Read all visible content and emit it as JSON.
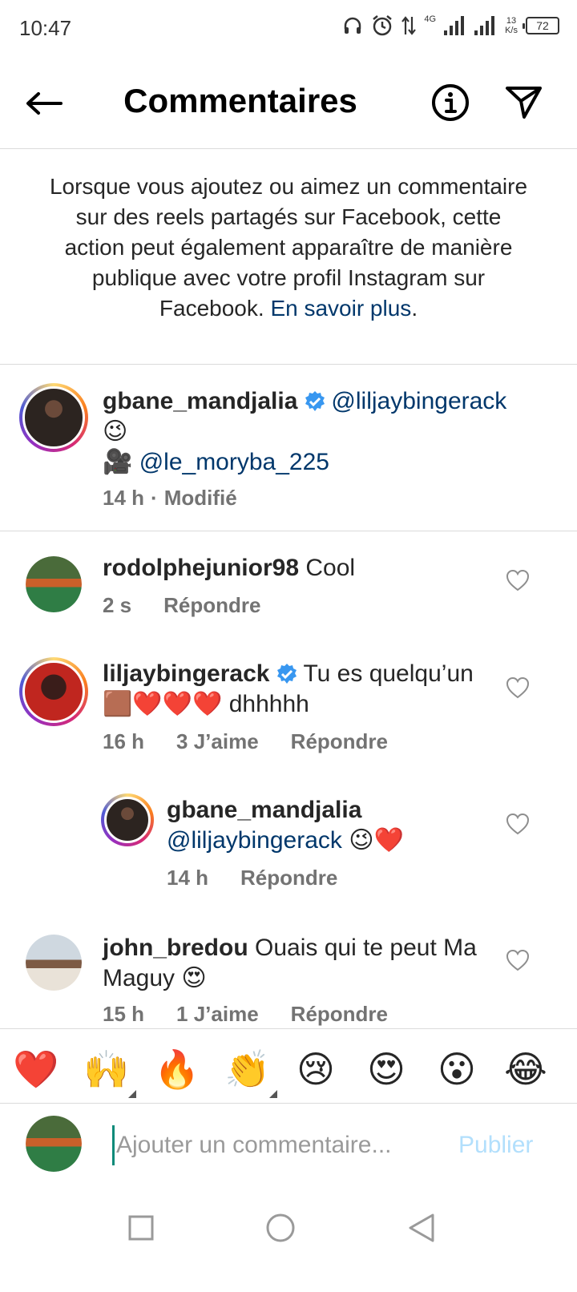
{
  "status_bar": {
    "time": "10:47",
    "network": "4G",
    "speed_value": "13",
    "speed_unit": "K/s",
    "battery": "72"
  },
  "header": {
    "title": "Commentaires",
    "back_icon": "arrow-left-icon",
    "info_icon": "info-circle-icon",
    "send_icon": "paper-plane-icon"
  },
  "notice": {
    "text": "Lorsque vous ajoutez ou aimez un commentaire sur des reels partagés sur Facebook, cette action peut également apparaître de manière publique avec votre profil Instagram sur Facebook. ",
    "link": "En savoir plus",
    "end": "."
  },
  "caption": {
    "username": "gbane_mandjalia",
    "mention1": "@liljaybingerack",
    "emoji1": "😉",
    "camera": "🎥",
    "mention2": "@le_moryba_225",
    "time": "14 h",
    "separator": "·",
    "edited": "Modifié"
  },
  "comments": [
    {
      "username": "rodolphejunior98",
      "text": "Cool",
      "time": "2 s",
      "reply": "Répondre"
    },
    {
      "username": "liljaybingerack",
      "text": "Tu es quelqu’un",
      "text2": "🟫❤️❤️❤️ dhhhhh",
      "time": "16 h",
      "likes": "3 J’aime",
      "reply": "Répondre"
    },
    {
      "username": "gbane_mandjalia",
      "mention": "@liljaybingerack",
      "text": "😉❤️",
      "time": "14 h",
      "reply": "Répondre"
    },
    {
      "username": "john_bredou",
      "text": "Ouais qui te peut Ma",
      "text2": "Maguy 😍",
      "time": "15 h",
      "likes": "1 J’aime",
      "reply": "Répondre"
    }
  ],
  "emoji_bar": [
    "❤️",
    "🙌",
    "🔥",
    "👏",
    "😢",
    "😍",
    "😮",
    "😂"
  ],
  "input": {
    "placeholder": "Ajouter un commentaire...",
    "publish": "Publier"
  },
  "colors": {
    "link": "#00376b",
    "verified": "#3897f0",
    "publish_disabled": "#b2dffc",
    "muted": "#737373"
  }
}
